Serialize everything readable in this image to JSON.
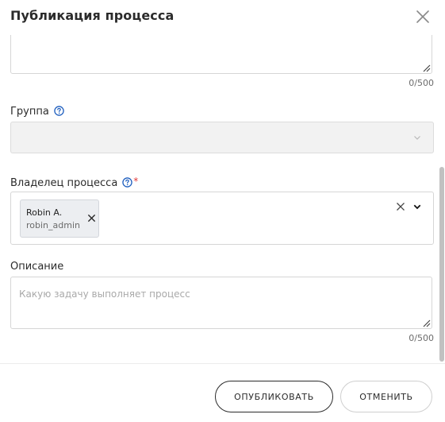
{
  "dialog": {
    "title": "Публикация процесса",
    "close_icon": "close-icon"
  },
  "top_textarea": {
    "value": "",
    "counter": "0/500"
  },
  "group_field": {
    "label": "Группа",
    "help_icon": "help-circle-icon",
    "selected": "",
    "disabled": true
  },
  "owner_field": {
    "label": "Владелец процесса",
    "required_mark": "*",
    "help_icon": "help-circle-icon",
    "chips": [
      {
        "name": "Robin A.",
        "login": "robin_admin"
      }
    ]
  },
  "description_field": {
    "label": "Описание",
    "placeholder": "Какую задачу выполняет процесс",
    "counter": "0/500"
  },
  "footer": {
    "publish_label": "ОПУБЛИКОВАТЬ",
    "cancel_label": "ОТМЕНИТЬ"
  },
  "colors": {
    "accent": "#1f5fbf",
    "required": "#e03a3a",
    "border": "#d6d6d6",
    "disabled_bg": "#f2f2f2"
  }
}
